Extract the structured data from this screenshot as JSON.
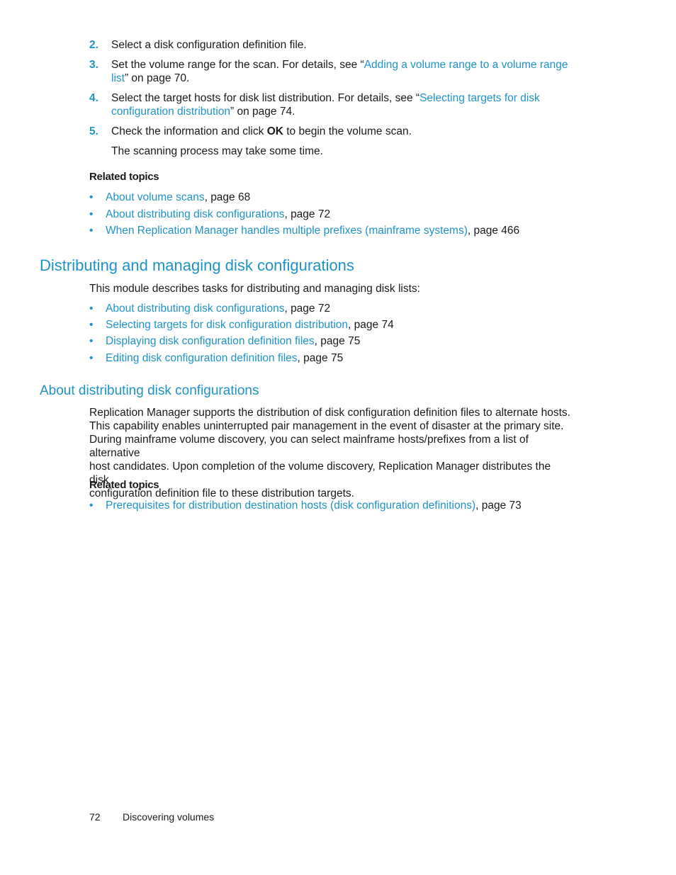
{
  "steps": [
    {
      "num": "2.",
      "text": "Select a disk configuration definition file."
    },
    {
      "num": "3.",
      "pre": "Set the volume range for the scan. For details, see “",
      "link": "Adding a volume range to a volume range list",
      "post": "” on page 70."
    },
    {
      "num": "4.",
      "pre": "Select the target hosts for disk list distribution. For details, see “",
      "link": "Selecting targets for disk configuration distribution",
      "post": "” on page 74."
    },
    {
      "num": "5.",
      "pre": "Check the information and click ",
      "bold": "OK",
      "post": " to begin the volume scan."
    }
  ],
  "step5_note": "The scanning process may take some time.",
  "related_topics_1": {
    "heading": "Related topics",
    "items": [
      {
        "link": "About volume scans",
        "suffix": ", page 68"
      },
      {
        "link": "About distributing disk configurations",
        "suffix": ", page 72"
      },
      {
        "link": "When Replication Manager handles multiple prefixes (mainframe systems)",
        "suffix": ", page 466"
      }
    ]
  },
  "section": {
    "title": "Distributing and managing disk configurations",
    "intro": "This module describes tasks for distributing and managing disk lists:",
    "items": [
      {
        "link": "About distributing disk configurations",
        "suffix": ", page 72"
      },
      {
        "link": "Selecting targets for disk configuration distribution",
        "suffix": ", page 74"
      },
      {
        "link": "Displaying disk configuration definition files",
        "suffix": ", page 75"
      },
      {
        "link": "Editing disk configuration definition files",
        "suffix": ", page 75"
      }
    ]
  },
  "subsection": {
    "title": "About distributing disk configurations",
    "lines": [
      "Replication Manager supports the distribution of disk configuration definition files to alternate hosts.",
      "This capability enables uninterrupted pair management in the event of disaster at the primary site.",
      "During mainframe volume discovery, you can select mainframe hosts/prefixes from a list of alternative",
      "host candidates. Upon completion of the volume discovery, Replication Manager distributes the disk",
      "configuration definition file to these distribution targets."
    ],
    "related_heading": "Related topics",
    "related_items": [
      {
        "link": "Prerequisites for distribution destination hosts (disk configuration definitions)",
        "suffix": ", page 73"
      }
    ]
  },
  "bullet_glyph": "•",
  "footer": {
    "page_number": "72",
    "chapter": "Discovering volumes"
  },
  "colors": {
    "accent": "#1f93c8",
    "text": "#1a1a1a"
  }
}
